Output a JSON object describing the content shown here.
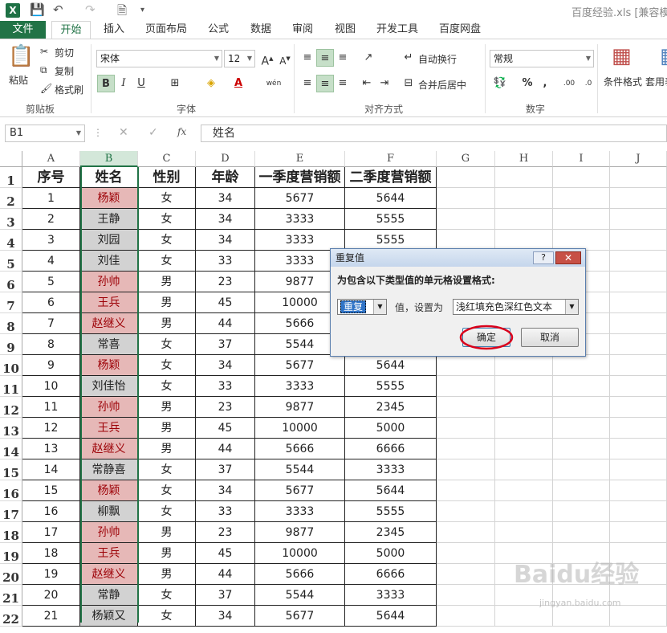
{
  "window": {
    "title": "百度经验.xls  [兼容模式]"
  },
  "ribbon": {
    "tabs": [
      "文件",
      "开始",
      "插入",
      "页面布局",
      "公式",
      "数据",
      "审阅",
      "视图",
      "开发工具",
      "百度网盘"
    ],
    "clipboard": {
      "paste": "粘贴",
      "cut": "剪切",
      "copy": "复制",
      "format_painter": "格式刷",
      "label": "剪贴板"
    },
    "font": {
      "name": "宋体",
      "size": "12",
      "label": "字体"
    },
    "alignment": {
      "wrap": "自动换行",
      "merge": "合并后居中",
      "label": "对齐方式"
    },
    "number": {
      "format": "常规",
      "label": "数字"
    },
    "styles": {
      "conditional": "条件格式",
      "table": "套用表格格式"
    }
  },
  "formula_bar": {
    "name_box": "B1",
    "content": "姓名"
  },
  "sheet": {
    "columns": [
      "A",
      "B",
      "C",
      "D",
      "E",
      "F",
      "G",
      "H",
      "I",
      "J"
    ],
    "selected_column": "B",
    "header_row": [
      "序号",
      "姓名",
      "性别",
      "年龄",
      "一季度营销额",
      "二季度营销额"
    ],
    "rows": [
      [
        "1",
        "杨颖",
        "女",
        "34",
        "5677",
        "5644"
      ],
      [
        "2",
        "王静",
        "女",
        "34",
        "3333",
        "5555"
      ],
      [
        "3",
        "刘园",
        "女",
        "34",
        "3333",
        "5555"
      ],
      [
        "4",
        "刘佳",
        "女",
        "33",
        "3333",
        ""
      ],
      [
        "5",
        "孙帅",
        "男",
        "23",
        "9877",
        ""
      ],
      [
        "6",
        "王兵",
        "男",
        "45",
        "10000",
        ""
      ],
      [
        "7",
        "赵继义",
        "男",
        "44",
        "5666",
        ""
      ],
      [
        "8",
        "常喜",
        "女",
        "37",
        "5544",
        ""
      ],
      [
        "9",
        "杨颖",
        "女",
        "34",
        "5677",
        "5644"
      ],
      [
        "10",
        "刘佳怡",
        "女",
        "33",
        "3333",
        "5555"
      ],
      [
        "11",
        "孙帅",
        "男",
        "23",
        "9877",
        "2345"
      ],
      [
        "12",
        "王兵",
        "男",
        "45",
        "10000",
        "5000"
      ],
      [
        "13",
        "赵继义",
        "男",
        "44",
        "5666",
        "6666"
      ],
      [
        "14",
        "常静喜",
        "女",
        "37",
        "5544",
        "3333"
      ],
      [
        "15",
        "杨颖",
        "女",
        "34",
        "5677",
        "5644"
      ],
      [
        "16",
        "柳飘",
        "女",
        "33",
        "3333",
        "5555"
      ],
      [
        "17",
        "孙帅",
        "男",
        "23",
        "9877",
        "2345"
      ],
      [
        "18",
        "王兵",
        "男",
        "45",
        "10000",
        "5000"
      ],
      [
        "19",
        "赵继义",
        "男",
        "44",
        "5666",
        "6666"
      ],
      [
        "20",
        "常静",
        "女",
        "37",
        "5544",
        "3333"
      ],
      [
        "21",
        "杨颖又",
        "女",
        "34",
        "5677",
        "5644"
      ]
    ],
    "duplicate_rows": [
      1,
      5,
      6,
      7,
      9,
      11,
      12,
      13,
      15,
      17,
      18,
      19
    ]
  },
  "dialog": {
    "title": "重复值",
    "prompt": "为包含以下类型值的单元格设置格式:",
    "type_value": "重复",
    "mid_label": "值，设置为",
    "format_value": "浅红填充色深红色文本",
    "ok": "确定",
    "cancel": "取消",
    "help": "?",
    "close": "✕"
  },
  "watermark": {
    "main": "Baidu经验",
    "sub": "jingyan.baidu.com"
  },
  "colors": {
    "excel_green": "#217346",
    "duplicate_fill": "#e6b8b7",
    "duplicate_text": "#9c0006",
    "unique_fill": "#d2d2d2",
    "ok_highlight": "#d9001b"
  }
}
